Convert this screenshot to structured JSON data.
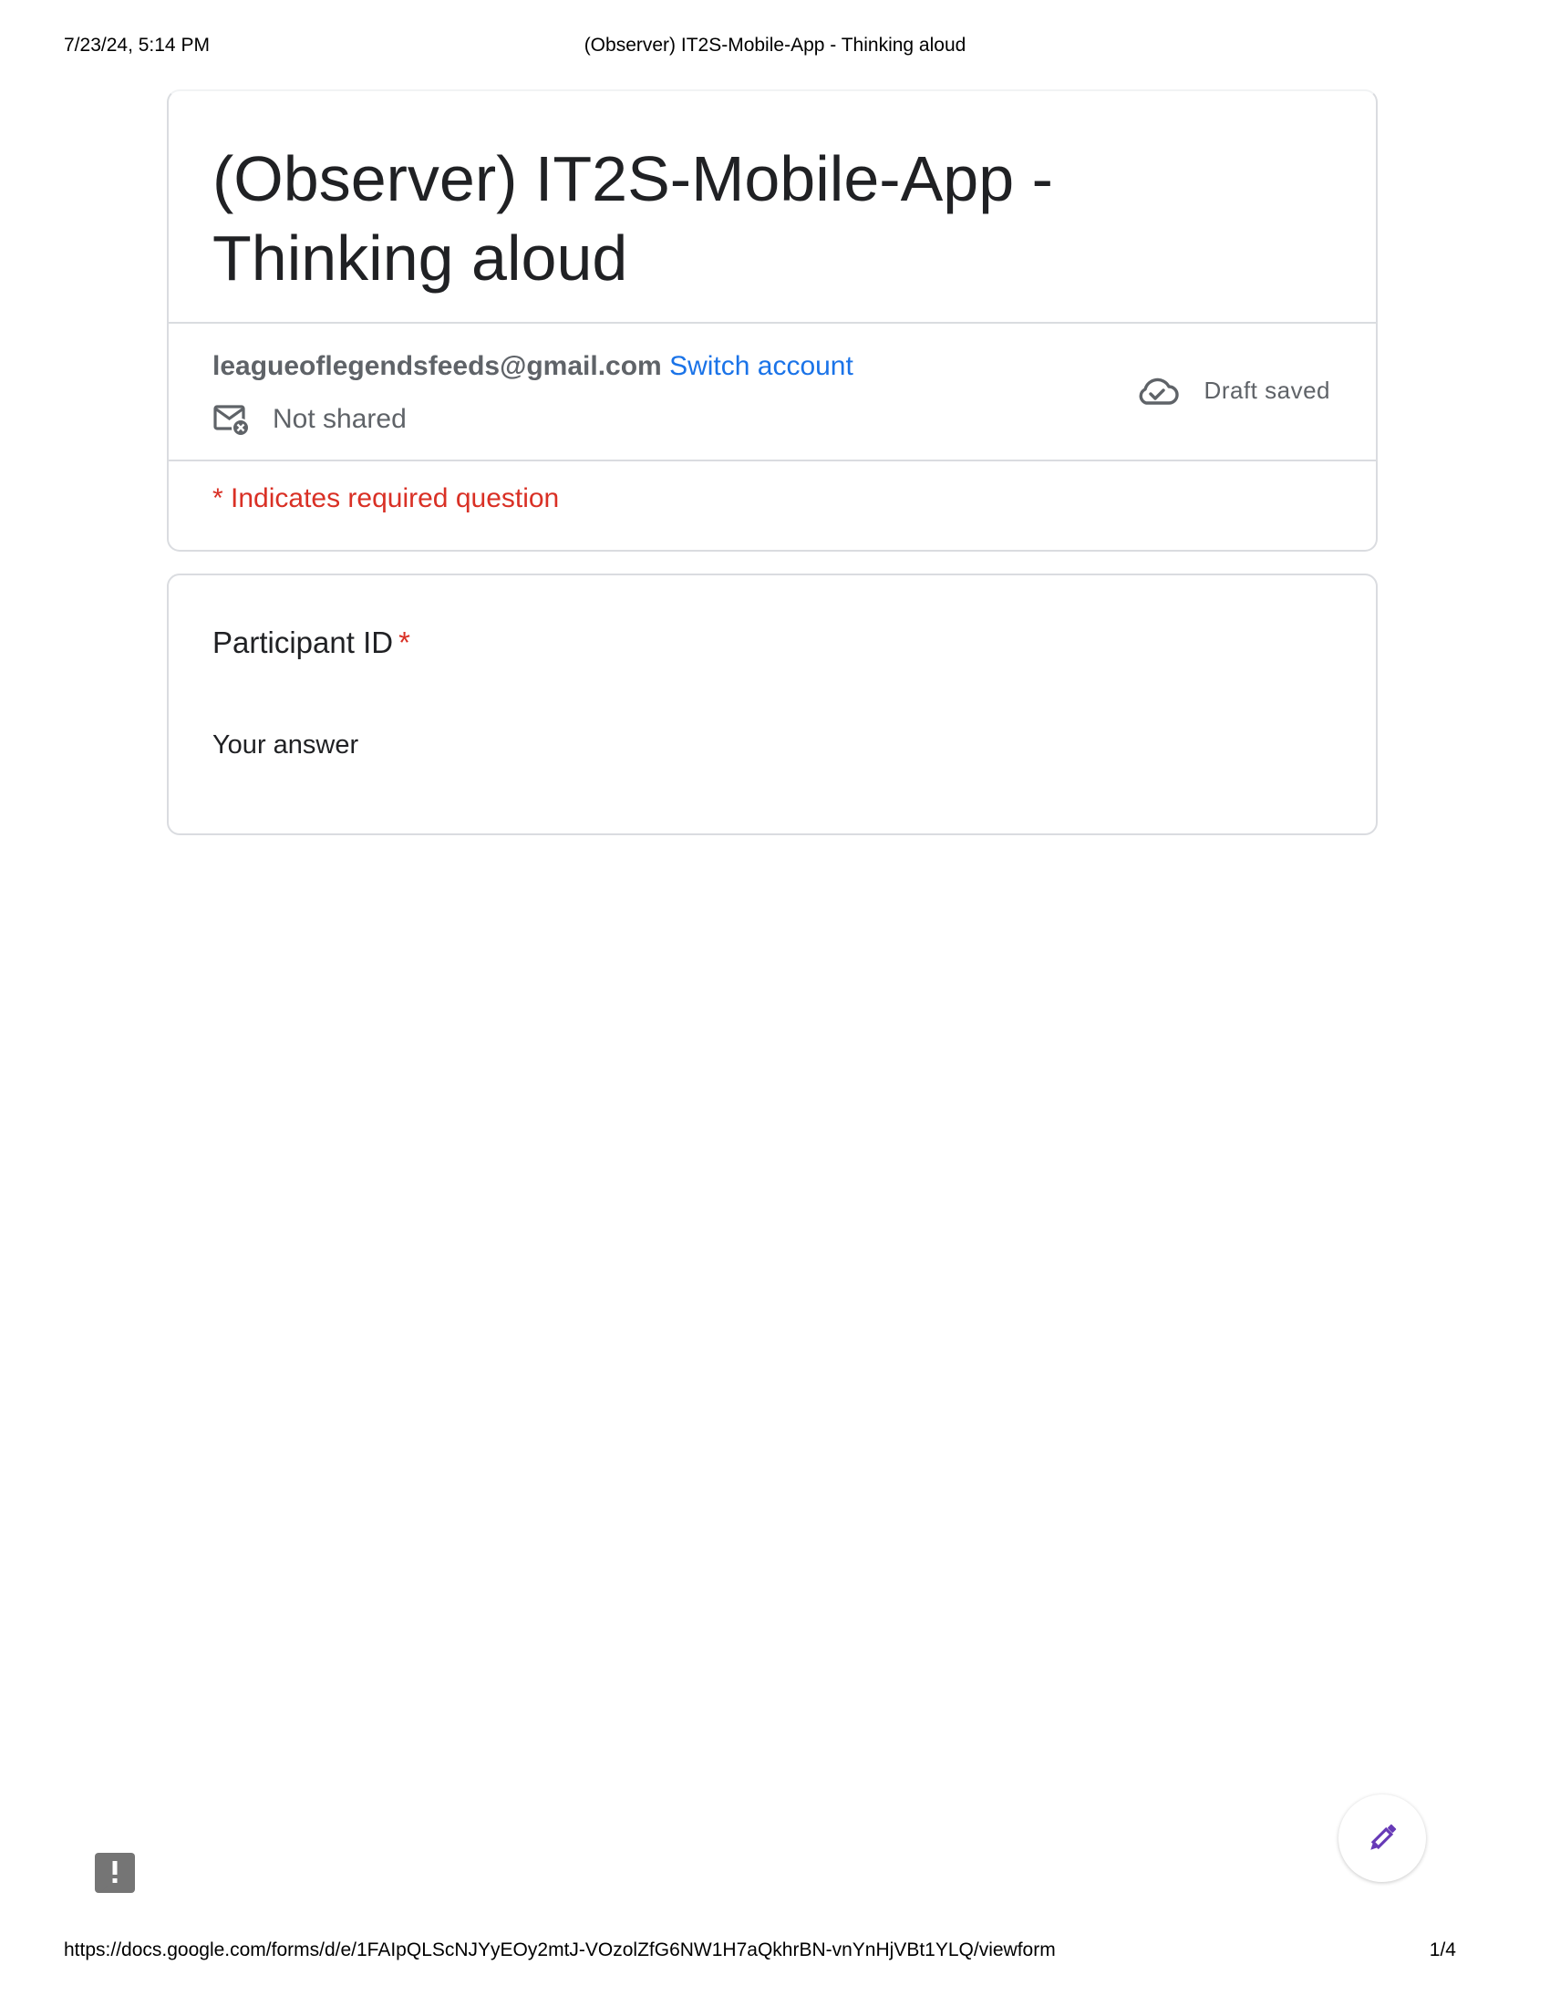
{
  "print_header": {
    "date": "7/23/24, 5:14 PM",
    "title": "(Observer) IT2S-Mobile-App - Thinking aloud"
  },
  "form": {
    "title": "(Observer) IT2S-Mobile-App - Thinking aloud",
    "account_email": "leagueoflegendsfeeds@gmail.com",
    "switch_account": "Switch account",
    "not_shared": "Not shared",
    "draft_status": "Draft saved",
    "required_note": "* Indicates required question"
  },
  "questions": [
    {
      "label": "Participant ID",
      "required_marker": "*",
      "placeholder": "Your answer"
    }
  ],
  "print_footer": {
    "url": "https://docs.google.com/forms/d/e/1FAIpQLScNJYyEOy2mtJ-VOzolZfG6NW1H7aQkhrBN-vnYnHjVBt1YLQ/viewform",
    "page": "1/4"
  },
  "colors": {
    "link": "#1a73e8",
    "required": "#d93025",
    "fab_icon": "#673ab7",
    "muted": "#5f6368"
  },
  "icons": {
    "not_shared": "mail-x-icon",
    "draft": "cloud-check-icon",
    "report": "report-problem-icon",
    "fab": "pencil-edit-icon"
  }
}
